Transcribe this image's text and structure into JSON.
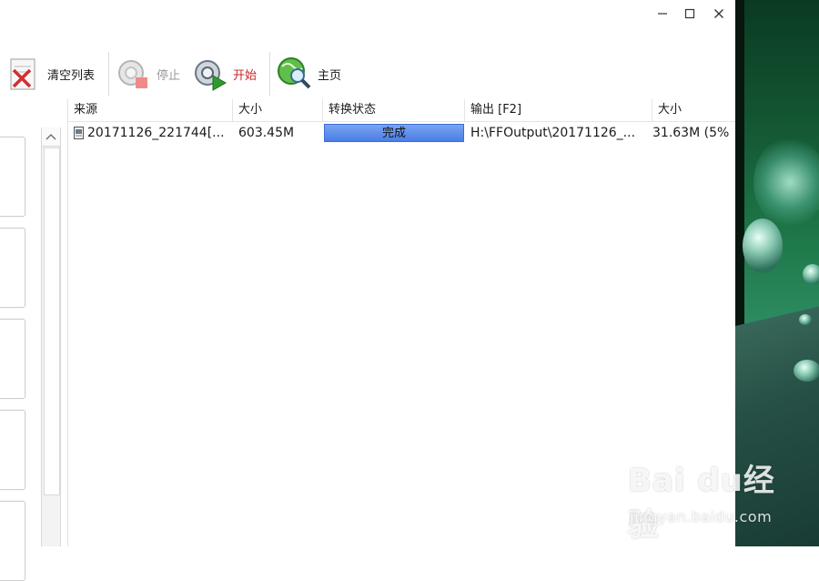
{
  "window_controls": {
    "minimize_icon": "minimize-icon",
    "maximize_icon": "maximize-icon",
    "close_icon": "close-icon"
  },
  "toolbar": {
    "clear_list_label": "清空列表",
    "stop_label": "停止",
    "start_label": "开始",
    "home_label": "主页",
    "colors": {
      "start": "#c62828",
      "stop_disabled": "#9a9a9a"
    }
  },
  "list": {
    "columns": [
      "来源",
      "大小",
      "转换状态",
      "输出 [F2]",
      "大小"
    ],
    "rows": [
      {
        "source": "20171126_221744[...",
        "size": "603.45M",
        "status": "完成",
        "output": "H:\\FFOutput\\20171126_...",
        "out_size": "31.63M  (5%"
      }
    ]
  },
  "watermark": {
    "brand": "Bai du经验",
    "url": "jingyan.baidu.com"
  }
}
